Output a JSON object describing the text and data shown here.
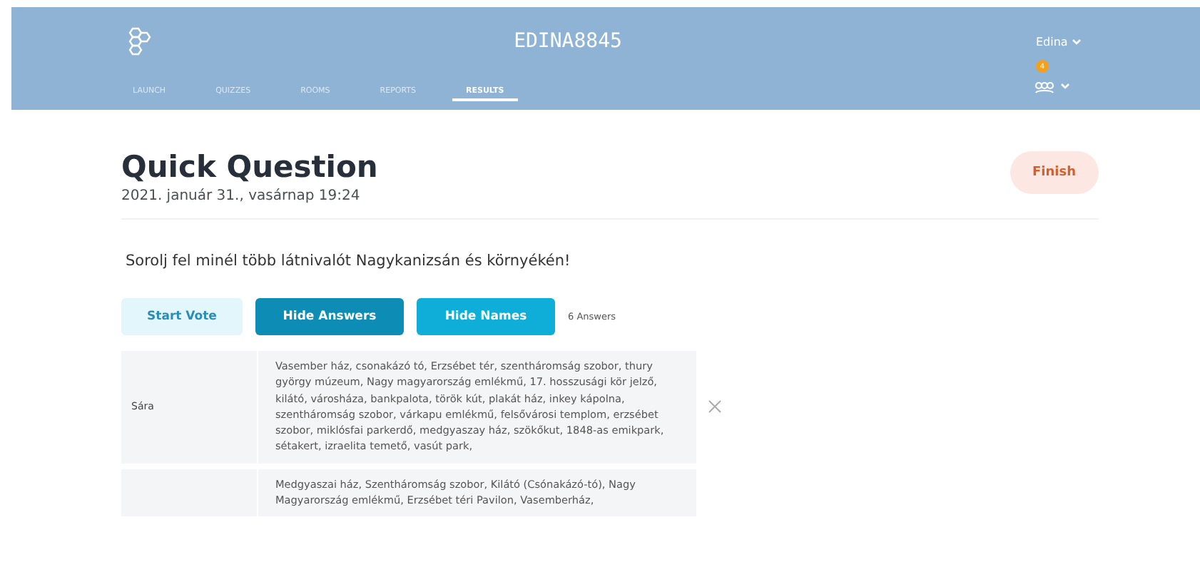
{
  "header": {
    "room": "EDINA8845",
    "user": "Edina",
    "badge": "4",
    "tabs": [
      {
        "label": "LAUNCH",
        "selected": false
      },
      {
        "label": "QUIZZES",
        "selected": false
      },
      {
        "label": "ROOMS",
        "selected": false
      },
      {
        "label": "REPORTS",
        "selected": false
      },
      {
        "label": "RESULTS",
        "selected": true
      }
    ]
  },
  "title": "Quick Question",
  "date": "2021. január 31., vasárnap 19:24",
  "finish": "Finish",
  "question": "Sorolj fel minél több látnivalót Nagykanizsán és környékén!",
  "buttons": [
    {
      "label": "Start Vote",
      "kind": "light"
    },
    {
      "label": "Hide Answers",
      "kind": "dark"
    },
    {
      "label": "Hide Names",
      "kind": "bright"
    }
  ],
  "answer_count": "6 Answers",
  "rows": [
    {
      "name": "Sára",
      "answer": "Vasember ház, csonakázó tó, Erzsébet tér, szentháromság szobor, thury györgy múzeum, Nagy magyarország emlékmű, 17. hosszusági kör jelző, kilátó, városháza, bankpalota, török kút, plakát ház, inkey kápolna, szentháromság szobor, várkapu emlékmű, felsővárosi templom, erzsébet szobor, miklósfai parkerdő, medgyaszay ház, szökőkut, 1848-as emikpark, sétakert, izraelita temető, vasút park,",
      "removable": true
    },
    {
      "answer": "Medgyaszai ház, Szentháromság szobor, Kilátó (Csónakázó-tó), Nagy Magyarország emlékmű, Erzsébet téri Pavilon, Vasemberház,",
      "removable": false
    }
  ]
}
